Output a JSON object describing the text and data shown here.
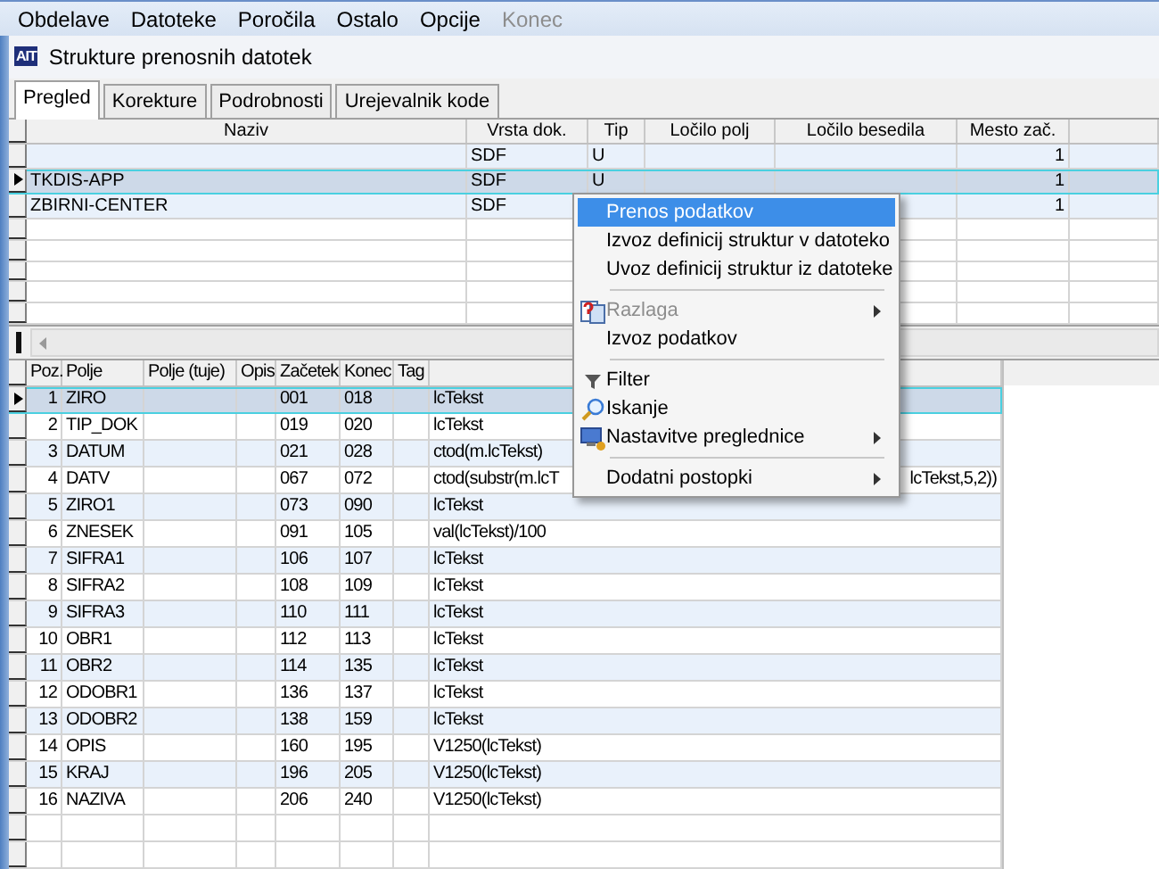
{
  "menu_bar": [
    {
      "label": "Obdelave",
      "disabled": false
    },
    {
      "label": "Datoteke",
      "disabled": false
    },
    {
      "label": "Poročila",
      "disabled": false
    },
    {
      "label": "Ostalo",
      "disabled": false
    },
    {
      "label": "Opcije",
      "disabled": false
    },
    {
      "label": "Konec",
      "disabled": true
    }
  ],
  "window": {
    "logo": "AIT",
    "title": "Strukture prenosnih datotek"
  },
  "tabs": [
    {
      "label": "Pregled",
      "selected": true
    },
    {
      "label": "Korekture",
      "selected": false
    },
    {
      "label": "Podrobnosti",
      "selected": false
    },
    {
      "label": "Urejevalnik kode",
      "selected": false
    }
  ],
  "structures_table": {
    "columns": [
      "Naziv",
      "Vrsta dok.",
      "Tip",
      "Ločilo polj",
      "Ločilo besedila",
      "Mesto zač."
    ],
    "rows": [
      {
        "selected": false,
        "cells": [
          "",
          "SDF",
          "U",
          "",
          "",
          "1"
        ]
      },
      {
        "selected": true,
        "cells": [
          "TKDIS-APP",
          "SDF",
          "U",
          "",
          "",
          "1"
        ]
      },
      {
        "selected": false,
        "cells": [
          "ZBIRNI-CENTER",
          "SDF",
          "",
          "",
          "",
          "1"
        ]
      }
    ]
  },
  "fields_table": {
    "columns": [
      "Poz.",
      "Polje",
      "Polje (tuje)",
      "Opis",
      "Začetek",
      "Konec",
      "Tag"
    ],
    "rows": [
      {
        "selected": true,
        "cells": [
          "1",
          "ZIRO",
          "",
          "",
          "001",
          "018",
          "",
          "lcTekst"
        ]
      },
      {
        "selected": false,
        "cells": [
          "2",
          "TIP_DOK",
          "",
          "",
          "019",
          "020",
          "",
          "lcTekst"
        ]
      },
      {
        "selected": false,
        "cells": [
          "3",
          "DATUM",
          "",
          "",
          "021",
          "028",
          "",
          "ctod(m.lcTekst)"
        ]
      },
      {
        "selected": false,
        "cells": [
          "4",
          "DATV",
          "",
          "",
          "067",
          "072",
          "",
          "ctod(substr(m.lcT"
        ],
        "cell_tail": "lcTekst,5,2))"
      },
      {
        "selected": false,
        "cells": [
          "5",
          "ZIRO1",
          "",
          "",
          "073",
          "090",
          "",
          "lcTekst"
        ]
      },
      {
        "selected": false,
        "cells": [
          "6",
          "ZNESEK",
          "",
          "",
          "091",
          "105",
          "",
          "val(lcTekst)/100"
        ]
      },
      {
        "selected": false,
        "cells": [
          "7",
          "SIFRA1",
          "",
          "",
          "106",
          "107",
          "",
          "lcTekst"
        ]
      },
      {
        "selected": false,
        "cells": [
          "8",
          "SIFRA2",
          "",
          "",
          "108",
          "109",
          "",
          "lcTekst"
        ]
      },
      {
        "selected": false,
        "cells": [
          "9",
          "SIFRA3",
          "",
          "",
          "110",
          "111",
          "",
          "lcTekst"
        ]
      },
      {
        "selected": false,
        "cells": [
          "10",
          "OBR1",
          "",
          "",
          "112",
          "113",
          "",
          "lcTekst"
        ]
      },
      {
        "selected": false,
        "cells": [
          "11",
          "OBR2",
          "",
          "",
          "114",
          "135",
          "",
          "lcTekst"
        ]
      },
      {
        "selected": false,
        "cells": [
          "12",
          "ODOBR1",
          "",
          "",
          "136",
          "137",
          "",
          "lcTekst"
        ]
      },
      {
        "selected": false,
        "cells": [
          "13",
          "ODOBR2",
          "",
          "",
          "138",
          "159",
          "",
          "lcTekst"
        ]
      },
      {
        "selected": false,
        "cells": [
          "14",
          "OPIS",
          "",
          "",
          "160",
          "195",
          "",
          "V1250(lcTekst)"
        ]
      },
      {
        "selected": false,
        "cells": [
          "15",
          "KRAJ",
          "",
          "",
          "196",
          "205",
          "",
          "V1250(lcTekst)"
        ]
      },
      {
        "selected": false,
        "cells": [
          "16",
          "NAZIVA",
          "",
          "",
          "206",
          "240",
          "",
          "V1250(lcTekst)"
        ]
      }
    ]
  },
  "context_menu": [
    {
      "kind": "item",
      "label": "Prenos podatkov",
      "selected": true,
      "disabled": false,
      "submenu": false
    },
    {
      "kind": "item",
      "label": "Izvoz definicij struktur v datoteko",
      "selected": false,
      "disabled": false,
      "submenu": false
    },
    {
      "kind": "item",
      "label": "Uvoz definicij struktur iz datoteke",
      "selected": false,
      "disabled": false,
      "submenu": false
    },
    {
      "kind": "separator"
    },
    {
      "kind": "item",
      "label": "Razlaga",
      "selected": false,
      "disabled": true,
      "submenu": true
    },
    {
      "kind": "item",
      "label": "Izvoz podatkov",
      "selected": false,
      "disabled": false,
      "submenu": false
    },
    {
      "kind": "separator"
    },
    {
      "kind": "item",
      "label": "Filter",
      "selected": false,
      "disabled": false,
      "submenu": false
    },
    {
      "kind": "item",
      "label": "Iskanje",
      "selected": false,
      "disabled": false,
      "submenu": false
    },
    {
      "kind": "item",
      "label": "Nastavitve preglednice",
      "selected": false,
      "disabled": false,
      "submenu": true
    },
    {
      "kind": "separator"
    },
    {
      "kind": "item",
      "label": "Dodatni postopki",
      "selected": false,
      "disabled": false,
      "submenu": true
    }
  ]
}
